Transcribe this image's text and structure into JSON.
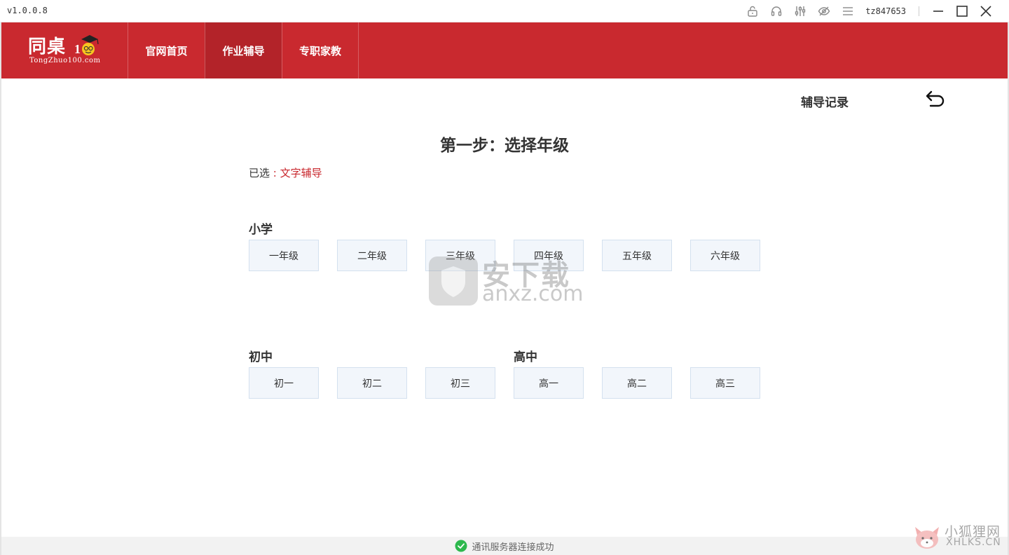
{
  "titlebar": {
    "version": "v1.0.0.8",
    "username": "tz847653",
    "icons": [
      "lock-icon",
      "headset-icon",
      "sliders-icon",
      "eye-icon",
      "menu-icon"
    ]
  },
  "header": {
    "logo_text": "同桌",
    "logo_sub": "TongZhuo100.com",
    "logo_mark": "100",
    "nav": [
      {
        "label": "官网首页"
      },
      {
        "label": "作业辅导"
      },
      {
        "label": "专职家教"
      }
    ],
    "colors": {
      "brand": "#c9292f",
      "active": "#b32329"
    }
  },
  "main": {
    "record_link": "辅导记录",
    "step_title": "第一步：选择年级",
    "selected_label": "已选",
    "selected_sep": " : ",
    "selected_value": "文字辅导",
    "primary": {
      "label": "小学",
      "grades": [
        "一年级",
        "二年级",
        "三年级",
        "四年级",
        "五年级",
        "六年级"
      ]
    },
    "junior": {
      "label": "初中",
      "grades": [
        "初一",
        "初二",
        "初三"
      ]
    },
    "senior": {
      "label": "高中",
      "grades": [
        "高一",
        "高二",
        "高三"
      ]
    }
  },
  "watermark": {
    "text": "安下载",
    "url": "anxz.com",
    "corner_cn": "小狐狸网",
    "corner_en": "XHLKS.CN"
  },
  "status": {
    "text": "通讯服务器连接成功",
    "color": "#2db84d"
  }
}
